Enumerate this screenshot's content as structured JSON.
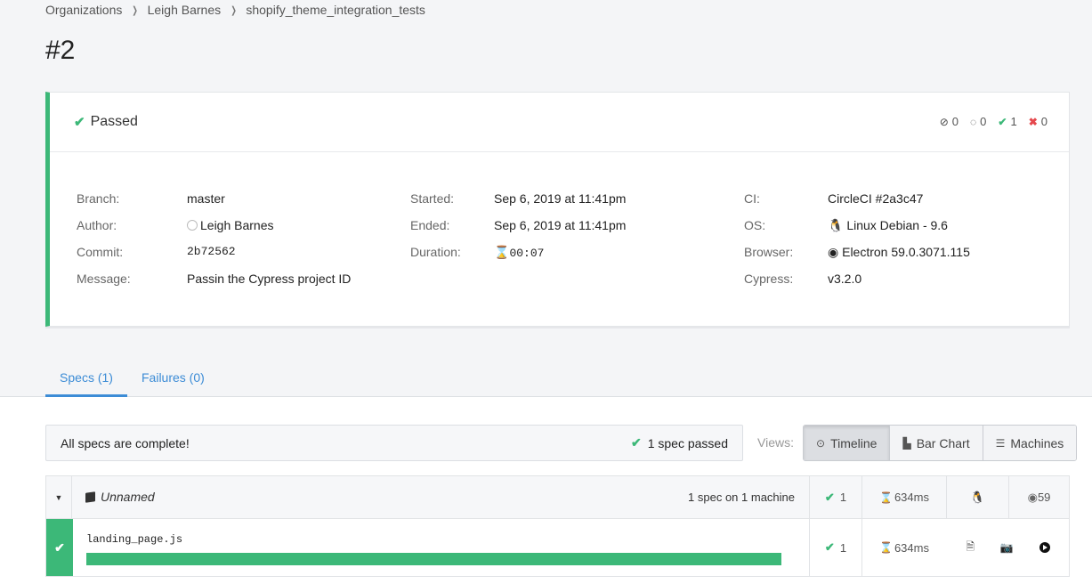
{
  "breadcrumb": {
    "items": [
      "Organizations",
      "Leigh Barnes",
      "shopify_theme_integration_tests"
    ],
    "separator": ">"
  },
  "page_title": "#2",
  "run": {
    "status": "Passed",
    "counts": {
      "skipped": "0",
      "pending": "0",
      "passed": "1",
      "failed": "0"
    },
    "meta_left": [
      {
        "label": "Branch:",
        "value": "master"
      },
      {
        "label": "Author:",
        "value": "Leigh Barnes"
      },
      {
        "label": "Commit:",
        "value": "2b72562"
      },
      {
        "label": "Message:",
        "value": "Passin the Cypress project ID"
      }
    ],
    "meta_mid": [
      {
        "label": "Started:",
        "value": "Sep 6, 2019 at 11:41pm"
      },
      {
        "label": "Ended:",
        "value": "Sep 6, 2019 at 11:41pm"
      },
      {
        "label": "Duration:",
        "value": "00:07"
      }
    ],
    "meta_right": [
      {
        "label": "CI:",
        "value": "CircleCI #2a3c47"
      },
      {
        "label": "OS:",
        "value": "Linux Debian - 9.6"
      },
      {
        "label": "Browser:",
        "value": "Electron 59.0.3071.115"
      },
      {
        "label": "Cypress:",
        "value": "v3.2.0"
      }
    ]
  },
  "tabs": [
    {
      "label": "Specs (1)",
      "active": true
    },
    {
      "label": "Failures (0)",
      "active": false
    }
  ],
  "alert": {
    "message": "All specs are complete!",
    "summary": "1 spec passed"
  },
  "views": {
    "label": "Views:",
    "buttons": [
      "Timeline",
      "Bar Chart",
      "Machines"
    ],
    "active": "Timeline"
  },
  "group": {
    "name": "Unnamed",
    "machines": "1 spec on 1 machine",
    "passed": "1",
    "duration": "634ms",
    "browser_version": "59"
  },
  "specs": [
    {
      "name": "landing_page.js",
      "passed": "1",
      "duration": "634ms",
      "progress": 1.0
    }
  ],
  "colors": {
    "success": "#3cb878",
    "link": "#3c8cd6",
    "failure": "#e5484d"
  },
  "icons": {
    "status": "check-icon",
    "skipped": "ban-icon",
    "pending": "circle-notch-icon",
    "passed": "check-icon",
    "failed": "times-icon",
    "duration": "hourglass-icon",
    "os": "linux-icon",
    "browser": "chrome-icon",
    "group": "cube-icon",
    "timeline": "clock-icon",
    "bar_chart": "bar-chart-icon",
    "machines": "server-icon",
    "spec_actions": [
      "file-icon",
      "camera-icon",
      "play-circle-icon"
    ]
  }
}
